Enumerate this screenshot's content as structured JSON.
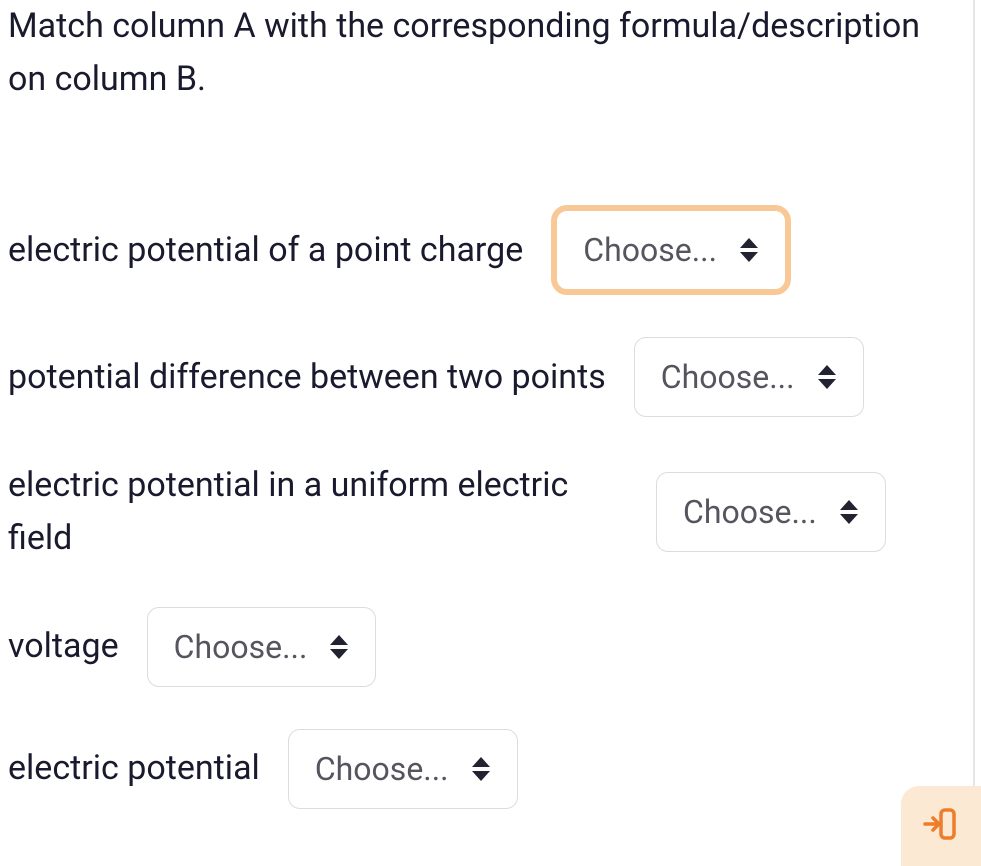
{
  "question": {
    "prompt": "Match column A with the corresponding formula/description on column B."
  },
  "items": [
    {
      "label": "electric potential of a point charge",
      "select_text": "Choose...",
      "highlighted": true
    },
    {
      "label": "potential difference between two points",
      "select_text": "Choose...",
      "highlighted": false
    },
    {
      "label": "electric potential in a uniform electric field",
      "select_text": "Choose...",
      "highlighted": false
    },
    {
      "label": "voltage",
      "select_text": "Choose...",
      "highlighted": false
    },
    {
      "label": "electric potential",
      "select_text": "Choose...",
      "highlighted": false
    }
  ]
}
